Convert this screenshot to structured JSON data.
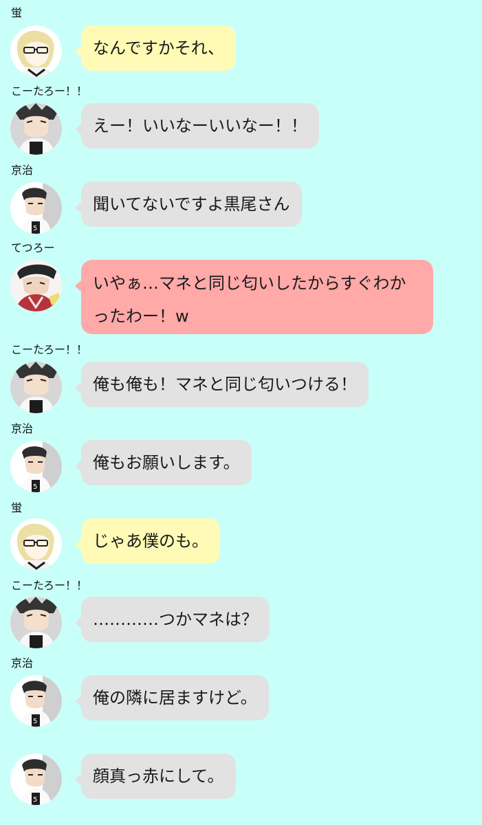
{
  "theme": {
    "background": "#c8fff8",
    "bubble_yellow": "#fffbb6",
    "bubble_gray": "#e2e2e2",
    "bubble_red": "#ffa9a9"
  },
  "messages": [
    {
      "sender": "蛍",
      "avatar": "tsukishima-avatar",
      "text": "なんですかそれ、"
    },
    {
      "sender": "こーたろー！！",
      "avatar": "bokuto-avatar",
      "text": "えー！いいなーいいなー！！"
    },
    {
      "sender": "京治",
      "avatar": "akaashi-avatar",
      "text": "聞いてないですよ黒尾さん"
    },
    {
      "sender": "てつろー",
      "avatar": "kuroo-avatar",
      "text": "いやぁ…マネと同じ匂いしたからすぐわかったわー！w"
    },
    {
      "sender": "こーたろー！！",
      "avatar": "bokuto-avatar",
      "text": "俺も俺も！マネと同じ匂いつける！"
    },
    {
      "sender": "京治",
      "avatar": "akaashi-avatar",
      "text": "俺もお願いします。"
    },
    {
      "sender": "蛍",
      "avatar": "tsukishima-avatar",
      "text": "じゃあ僕のも。"
    },
    {
      "sender": "こーたろー！！",
      "avatar": "bokuto-avatar",
      "text": "…………つかマネは？"
    },
    {
      "sender": "京治",
      "avatar": "akaashi-avatar",
      "text": "俺の隣に居ますけど。"
    },
    {
      "sender": "",
      "avatar": "akaashi-avatar",
      "text": "顔真っ赤にして。"
    }
  ]
}
